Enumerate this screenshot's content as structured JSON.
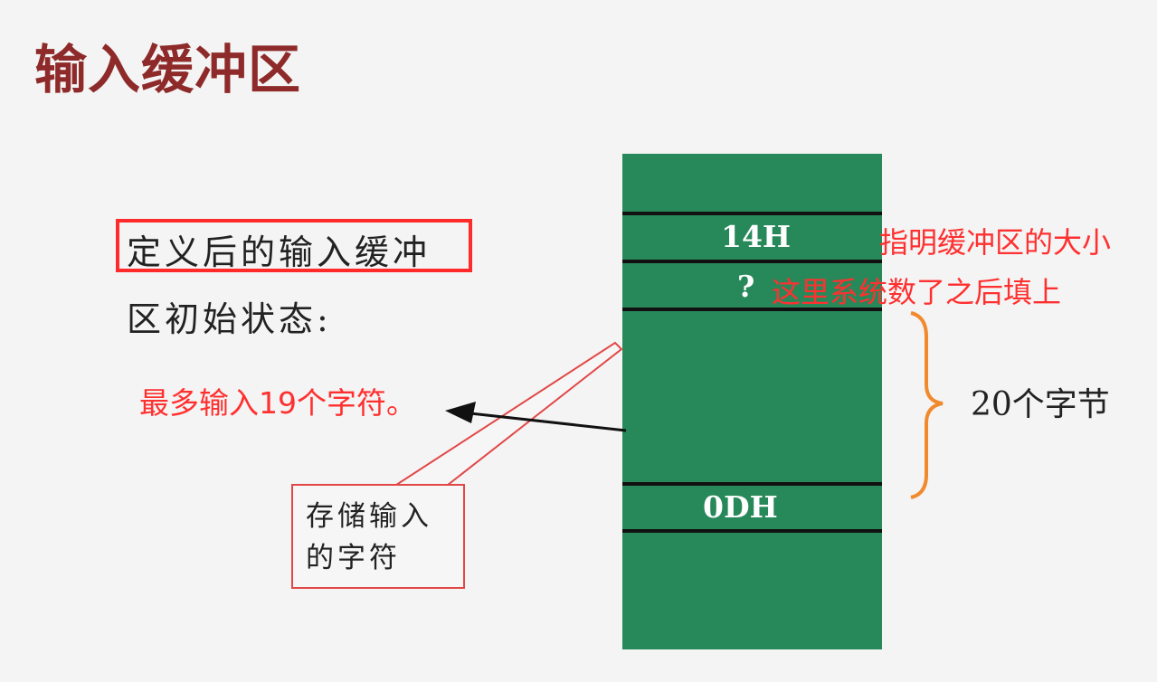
{
  "title": "输入缓冲区",
  "description": {
    "line1": "定义后的输入缓冲",
    "line2": "区初始状态:"
  },
  "annotations": {
    "max_chars": "最多输入19个字符。",
    "buffer_size": "指明缓冲区的大小",
    "filled_later": "这里系统数了之后填上"
  },
  "buffer": {
    "cells": {
      "size_cell": "14H",
      "count_cell": "?",
      "end_cell": "0DH"
    },
    "bytes_label": "20个字节"
  },
  "callout": {
    "text": "存储输入的字符"
  },
  "colors": {
    "title": "#8e2a2a",
    "annotation": "#ff3030",
    "buffer": "#27885a",
    "brace": "#f08a2d",
    "callout_border": "#e24747"
  }
}
